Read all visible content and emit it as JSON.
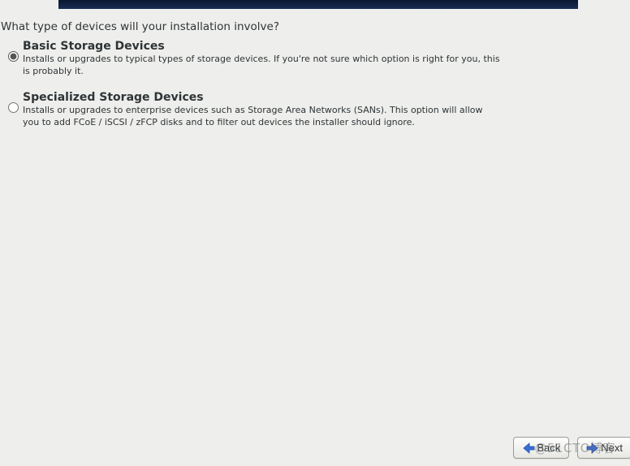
{
  "question": "What type of devices will your installation involve?",
  "options": [
    {
      "title": "Basic Storage Devices",
      "description": "Installs or upgrades to typical types of storage devices.  If you're not sure which option is right for you, this is probably it.",
      "selected": true
    },
    {
      "title": "Specialized Storage Devices",
      "description": "Installs or upgrades to enterprise devices such as Storage Area Networks (SANs). This option will allow you to add FCoE / iSCSI / zFCP disks and to filter out devices the installer should ignore.",
      "selected": false
    }
  ],
  "buttons": {
    "back_label": "Back",
    "next_label": "Next"
  },
  "watermark": "@51CTO博客"
}
